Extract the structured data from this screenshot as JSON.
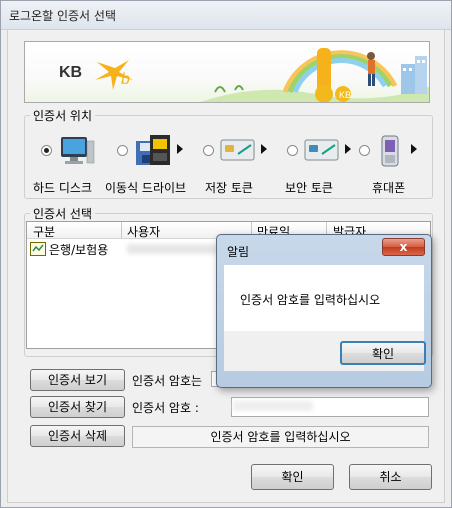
{
  "window": {
    "title": "로그온할 인증서 선택"
  },
  "banner": {
    "logo_text": "KB",
    "logo_mark": "★b",
    "colors": {
      "kb_yellow": "#f7b21b",
      "sky": "#cfe7f5",
      "grass": "#8cc63f"
    }
  },
  "location": {
    "group_label": "인증서 위치",
    "options": [
      {
        "label": "하드 디스크",
        "icon": "computer-icon",
        "selected": true,
        "has_arrow": false
      },
      {
        "label": "이동식 드라이브",
        "icon": "removable-drive-icon",
        "selected": false,
        "has_arrow": true
      },
      {
        "label": "저장 토큰",
        "icon": "storage-token-icon",
        "selected": false,
        "has_arrow": true
      },
      {
        "label": "보안 토큰",
        "icon": "security-token-icon",
        "selected": false,
        "has_arrow": true
      },
      {
        "label": "휴대폰",
        "icon": "phone-icon",
        "selected": false,
        "has_arrow": true
      }
    ]
  },
  "certs": {
    "group_label": "인증서 선택",
    "columns": [
      "구분",
      "사용자",
      "만료일",
      "발급자"
    ],
    "rows": [
      {
        "type": "은행/보험용",
        "icon": "certificate-icon"
      }
    ]
  },
  "actions": {
    "view_label": "인증서 보기",
    "find_label": "인증서 찾기",
    "delete_label": "인증서 삭제",
    "password_label_1": "인증서 암호는",
    "password_label_2": "인증서 암호 :",
    "password_value": "",
    "status_text": "인증서 암호를 입력하십시오"
  },
  "footer": {
    "ok_label": "확인",
    "cancel_label": "취소"
  },
  "alert": {
    "title": "알림",
    "close_label": "x",
    "message": "인증서 암호를 입력하십시오",
    "ok_label": "확인"
  }
}
